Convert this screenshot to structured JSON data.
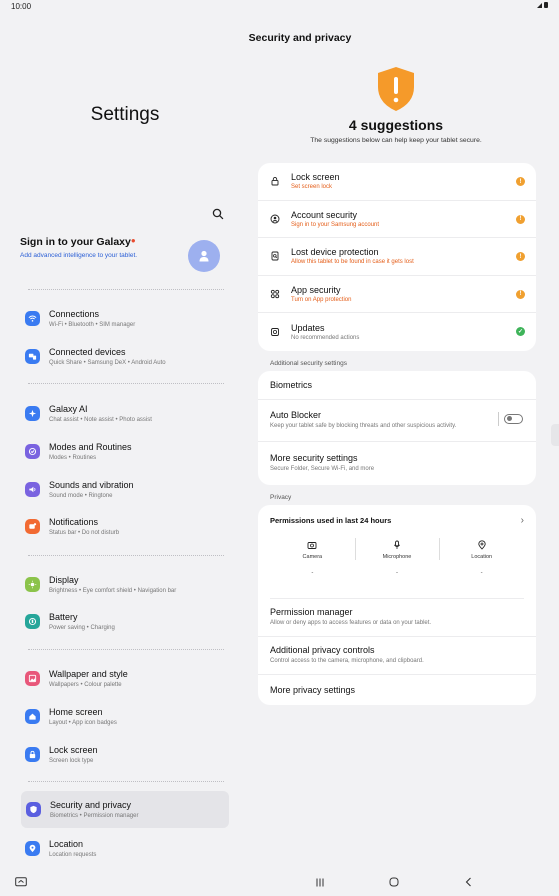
{
  "status_bar": {
    "time": "10:00"
  },
  "left": {
    "title": "Settings",
    "account": {
      "title": "Sign in to your Galaxy",
      "subtitle": "Add advanced intelligence to your tablet."
    },
    "items": [
      {
        "label": "Connections",
        "sub": "Wi-Fi  •  Bluetooth  •  SIM manager",
        "color": "#3a7bf1"
      },
      {
        "label": "Connected devices",
        "sub": "Quick Share  •  Samsung DeX  •  Android Auto",
        "color": "#3a7bf1"
      },
      {
        "label": "Galaxy AI",
        "sub": "Chat assist  •  Note assist  •  Photo assist",
        "color": "#3a7bf1"
      },
      {
        "label": "Modes and Routines",
        "sub": "Modes  •  Routines",
        "color": "#7a63e0"
      },
      {
        "label": "Sounds and vibration",
        "sub": "Sound mode  •  Ringtone",
        "color": "#7a63e0"
      },
      {
        "label": "Notifications",
        "sub": "Status bar  •  Do not disturb",
        "color": "#f26a32"
      },
      {
        "label": "Display",
        "sub": "Brightness  •  Eye comfort shield  •  Navigation bar",
        "color": "#8bc34a"
      },
      {
        "label": "Battery",
        "sub": "Power saving  •  Charging",
        "color": "#26a69a"
      },
      {
        "label": "Wallpaper and style",
        "sub": "Wallpapers  •  Colour palette",
        "color": "#e8577a"
      },
      {
        "label": "Home screen",
        "sub": "Layout  •  App icon badges",
        "color": "#3a7bf1"
      },
      {
        "label": "Lock screen",
        "sub": "Screen lock type",
        "color": "#3a7bf1"
      },
      {
        "label": "Security and privacy",
        "sub": "Biometrics  •  Permission manager",
        "color": "#5b5fe0"
      },
      {
        "label": "Location",
        "sub": "Location requests",
        "color": "#3a7bf1"
      }
    ]
  },
  "right": {
    "header": "Security and privacy",
    "suggestions_title": "4 suggestions",
    "suggestions_sub": "The suggestions below can help keep your tablet secure.",
    "suggestions": [
      {
        "label": "Lock screen",
        "sub": "Set screen lock",
        "status": "warn",
        "icon": "lock-icon"
      },
      {
        "label": "Account security",
        "sub": "Sign in to your Samsung account",
        "status": "warn",
        "icon": "account-icon"
      },
      {
        "label": "Lost device protection",
        "sub": "Allow this tablet to be found in case it gets lost",
        "status": "warn",
        "icon": "find-device-icon"
      },
      {
        "label": "App security",
        "sub": "Turn on App protection",
        "status": "warn",
        "icon": "apps-icon"
      },
      {
        "label": "Updates",
        "sub": "No recommended actions",
        "status": "ok",
        "icon": "update-icon"
      }
    ],
    "additional_label": "Additional security settings",
    "biometrics": "Biometrics",
    "auto_blocker": {
      "label": "Auto Blocker",
      "sub": "Keep your tablet safe by blocking threats and other suspicious activity."
    },
    "more_security": {
      "label": "More security settings",
      "sub": "Secure Folder, Secure Wi-Fi, and more"
    },
    "privacy_label": "Privacy",
    "permissions_head": "Permissions used in last 24 hours",
    "perm_cols": [
      {
        "name": "Camera",
        "value": "-"
      },
      {
        "name": "Microphone",
        "value": "-"
      },
      {
        "name": "Location",
        "value": "-"
      }
    ],
    "permission_manager": {
      "label": "Permission manager",
      "sub": "Allow or deny apps to access features or data on your tablet."
    },
    "additional_privacy": {
      "label": "Additional privacy controls",
      "sub": "Control access to the camera, microphone, and clipboard."
    },
    "more_privacy": "More privacy settings"
  },
  "colors": {
    "warn": "#f0a030",
    "ok": "#3fb45a",
    "accent": "#2b5fd6",
    "shield": "#f59a2a"
  }
}
